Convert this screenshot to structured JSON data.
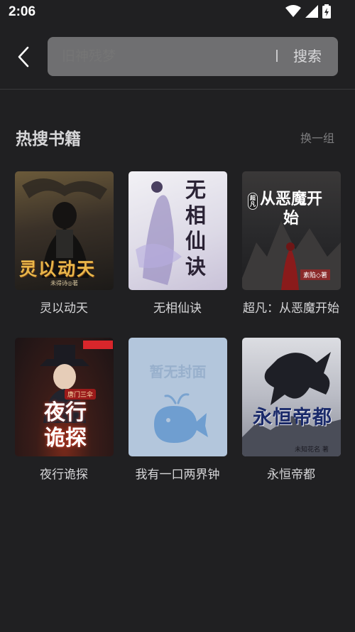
{
  "status_bar": {
    "time": "2:06"
  },
  "search": {
    "placeholder": "旧神残梦",
    "button_label": "搜索"
  },
  "section": {
    "title": "热搜书籍",
    "refresh_label": "换一组"
  },
  "books": [
    {
      "title": "灵以动天",
      "cover_text": "灵以动天",
      "cover_author": "未得诗◎著"
    },
    {
      "title": "无相仙诀",
      "cover_text": "无相仙诀"
    },
    {
      "title": "超凡：从恶魔开始",
      "cover_text": "从恶魔开始",
      "cover_badge": "超凡",
      "cover_author": "素陷◇著"
    },
    {
      "title": "夜行诡探",
      "cover_text": "夜行诡探",
      "cover_badge": "唐门三伞"
    },
    {
      "title": "我有一口两界钟",
      "cover_text": "暂无封面"
    },
    {
      "title": "永恒帝都",
      "cover_text": "永恒帝都",
      "cover_author": "未知花名 著"
    }
  ]
}
